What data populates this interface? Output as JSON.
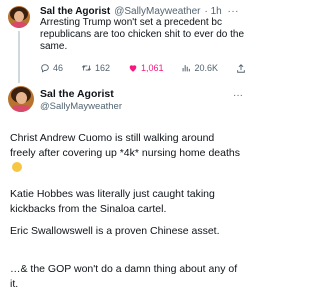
{
  "tweet1": {
    "display_name": "Sal the Agorist",
    "handle": "@SallyMayweather",
    "time": "· 1h",
    "more": "···",
    "text": "Arresting Trump won't set a precedent bc republicans are too chicken shit to ever do the same.",
    "replies": "46",
    "retweets": "162",
    "likes": "1,061",
    "views": "20.6K",
    "icons": [
      "reply-icon",
      "retweet-icon",
      "like-icon",
      "views-icon",
      "share-icon"
    ],
    "colors": {
      "like": "#f91880",
      "muted": "#536471"
    }
  },
  "tweet2": {
    "display_name": "Sal the Agorist",
    "handle": "@SallyMayweather",
    "more": "···",
    "paragraphs": [
      "Christ Andrew Cuomo is still walking around freely after covering up *4k* nursing home deaths",
      "Katie Hobbes was literally just caught taking kickbacks from the Sinaloa cartel.",
      "Eric Swallowswell is a proven Chinese asset.",
      "…& the GOP won't do a damn thing about any of it."
    ],
    "emoji": "flushed-face-emoji"
  }
}
